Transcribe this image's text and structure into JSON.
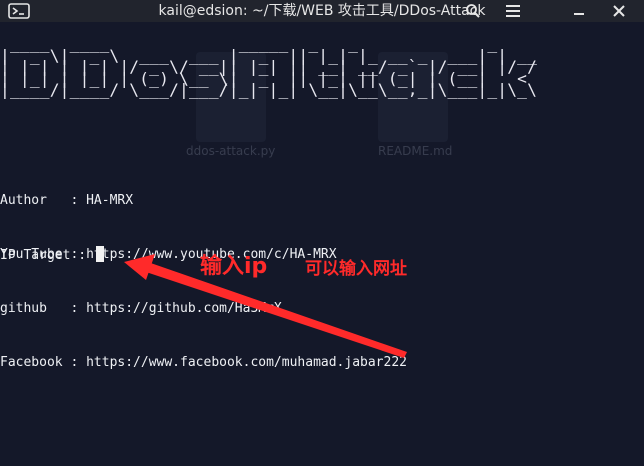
{
  "window": {
    "title": "kail@edsion: ~/下载/WEB 攻击工具/DDos-Attack"
  },
  "terminal": {
    "banner_lines": [
      " ____  ____             _____  _   _             _    ",
      "|  _ \\|  _ \\  ___  ___ |  _  || |_| |_ __ _  ___| | __",
      "| | | | | | |/ _ \\/ __|| |_| || __| __/ _` |/ __| |/ /",
      "| |_| | |_| | (_) \\__ \\|  _  || |_| || (_| | (__|   < ",
      "|____/|____/ \\___/|___/|_| |_| \\__|\\__\\__,_|\\___|_|\\_\\"
    ],
    "info_lines": [
      "Author   : HA-MRX",
      "You Tube : https://www.youtube.com/c/HA-MRX",
      "github   : https://github.com/Ha3MrX",
      "Facebook : https://www.facebook.com/muhamad.jabar222"
    ],
    "prompt": "IP Target : "
  },
  "background_ghost": {
    "file1": "ddos-attack.py",
    "file2": "README.md"
  },
  "annotations": {
    "label_1": "输入ip",
    "label_2": "可以输入网址",
    "color": "#ff2a2a"
  }
}
